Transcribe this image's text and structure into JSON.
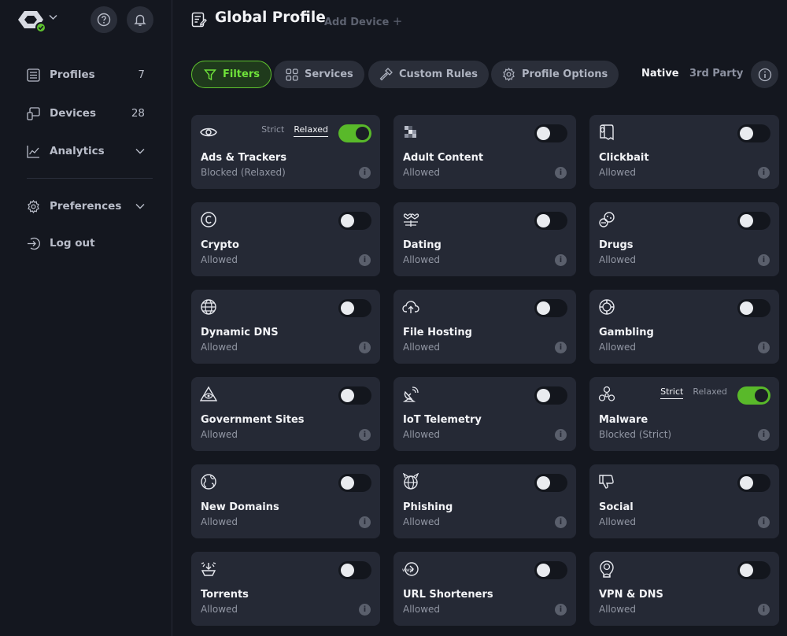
{
  "sidebar": {
    "nav": [
      {
        "label": "Profiles",
        "count": "7",
        "icon": "profiles-icon"
      },
      {
        "label": "Devices",
        "count": "28",
        "icon": "devices-icon"
      },
      {
        "label": "Analytics",
        "icon": "analytics-icon"
      },
      {
        "label": "Preferences",
        "icon": "gear-icon"
      },
      {
        "label": "Log out",
        "icon": "logout-icon"
      }
    ]
  },
  "header": {
    "title": "Global Profile",
    "add_device": "Add Device"
  },
  "tabs": [
    {
      "label": "Filters",
      "active": true
    },
    {
      "label": "Services"
    },
    {
      "label": "Custom Rules"
    },
    {
      "label": "Profile Options"
    }
  ],
  "source": {
    "native": "Native",
    "third_party": "3rd Party",
    "selected": "Native"
  },
  "modes": {
    "strict": "Strict",
    "relaxed": "Relaxed"
  },
  "colors": {
    "accent": "#5ec12e",
    "card": "#252935",
    "background": "#14171f"
  },
  "filters": [
    {
      "name": "Ads & Trackers",
      "status": "Blocked (Relaxed)",
      "on": true,
      "mode": "relaxed",
      "icon": "eye-icon"
    },
    {
      "name": "Adult Content",
      "status": "Allowed",
      "on": false,
      "icon": "pixelated-icon"
    },
    {
      "name": "Clickbait",
      "status": "Allowed",
      "on": false,
      "icon": "toilet-paper-icon"
    },
    {
      "name": "Crypto",
      "status": "Allowed",
      "on": false,
      "icon": "crypto-coin-icon"
    },
    {
      "name": "Dating",
      "status": "Allowed",
      "on": false,
      "icon": "dating-icon"
    },
    {
      "name": "Drugs",
      "status": "Allowed",
      "on": false,
      "icon": "pills-icon"
    },
    {
      "name": "Dynamic DNS",
      "status": "Allowed",
      "on": false,
      "icon": "globe-network-icon"
    },
    {
      "name": "File Hosting",
      "status": "Allowed",
      "on": false,
      "icon": "cloud-upload-icon"
    },
    {
      "name": "Gambling",
      "status": "Allowed",
      "on": false,
      "icon": "poker-chip-icon"
    },
    {
      "name": "Government Sites",
      "status": "Allowed",
      "on": false,
      "icon": "pyramid-eye-icon"
    },
    {
      "name": "IoT Telemetry",
      "status": "Allowed",
      "on": false,
      "icon": "satellite-dish-icon"
    },
    {
      "name": "Malware",
      "status": "Blocked (Strict)",
      "on": true,
      "mode": "strict",
      "icon": "biohazard-icon"
    },
    {
      "name": "New Domains",
      "status": "Allowed",
      "on": false,
      "icon": "globe-spark-icon"
    },
    {
      "name": "Phishing",
      "status": "Allowed",
      "on": false,
      "icon": "globe-horns-icon"
    },
    {
      "name": "Social",
      "status": "Allowed",
      "on": false,
      "icon": "thumbs-down-icon"
    },
    {
      "name": "Torrents",
      "status": "Allowed",
      "on": false,
      "icon": "torrent-icon"
    },
    {
      "name": "URL Shorteners",
      "status": "Allowed",
      "on": false,
      "icon": "url-shortener-icon"
    },
    {
      "name": "VPN & DNS",
      "status": "Allowed",
      "on": false,
      "icon": "vpn-shield-icon"
    }
  ]
}
